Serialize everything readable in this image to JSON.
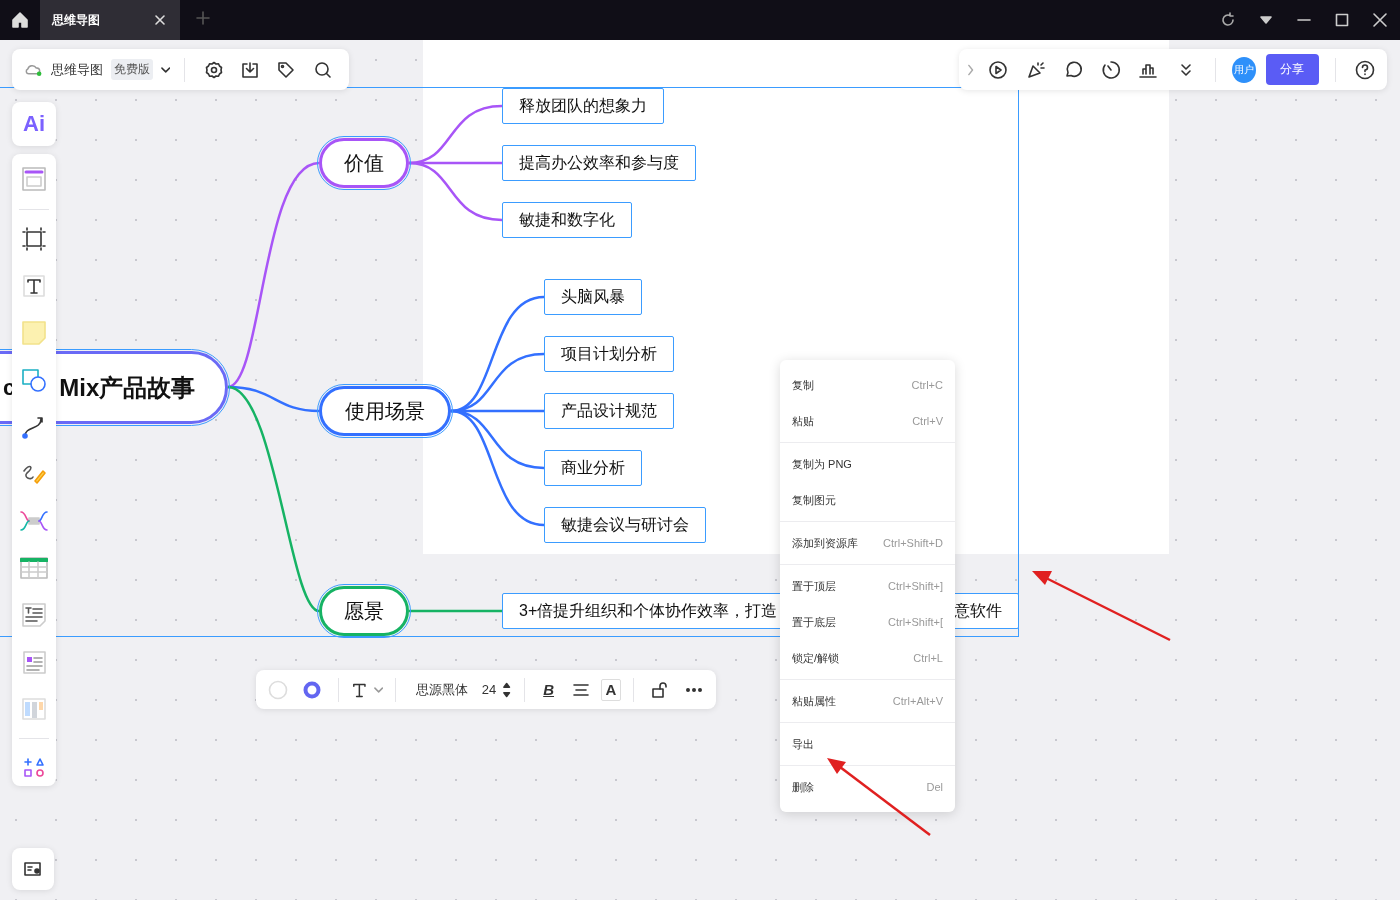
{
  "tab": {
    "title": "思维导图"
  },
  "doc_toolbar": {
    "title": "思维导图",
    "badge": "免费版"
  },
  "right_toolbar": {
    "avatar": "用户",
    "share": "分享"
  },
  "left_toolbar": {
    "ai_label": "Ai"
  },
  "mindmap": {
    "root": {
      "text_parts": [
        "c",
        "Mix产品故事"
      ]
    },
    "branches": [
      {
        "text": "价值",
        "color": "#a855f7",
        "children": [
          {
            "text": "释放团队的想象力"
          },
          {
            "text": "提高办公效率和参与度"
          },
          {
            "text": "敏捷和数字化"
          }
        ]
      },
      {
        "text": "使用场景",
        "color": "#3370ff",
        "children": [
          {
            "text": "头脑风暴"
          },
          {
            "text": "项目计划分析"
          },
          {
            "text": "产品设计规范"
          },
          {
            "text": "商业分析"
          },
          {
            "text": "敏捷会议与研讨会"
          }
        ]
      },
      {
        "text": "愿景",
        "color": "#16b364",
        "children": [
          {
            "text_parts": [
              "3+倍提升组织和个体协作效率，打造",
              "意软件"
            ]
          }
        ]
      }
    ]
  },
  "format_toolbar": {
    "font": "思源黑体",
    "size": "24",
    "bold_glyph": "B",
    "text_color_glyph": "A"
  },
  "context_menu": {
    "groups": [
      [
        {
          "label": "复制",
          "shortcut": "Ctrl+C"
        },
        {
          "label": "粘贴",
          "shortcut": "Ctrl+V"
        }
      ],
      [
        {
          "label": "复制为 PNG"
        },
        {
          "label": "复制图元"
        }
      ],
      [
        {
          "label": "添加到资源库",
          "shortcut": "Ctrl+Shift+D"
        }
      ],
      [
        {
          "label": "置于顶层",
          "shortcut": "Ctrl+Shift+]"
        },
        {
          "label": "置于底层",
          "shortcut": "Ctrl+Shift+["
        },
        {
          "label": "锁定/解锁",
          "shortcut": "Ctrl+L"
        }
      ],
      [
        {
          "label": "粘贴属性",
          "shortcut": "Ctrl+Alt+V"
        }
      ],
      [
        {
          "label": "导出"
        }
      ],
      [
        {
          "label": "删除",
          "shortcut": "Del"
        }
      ]
    ]
  }
}
